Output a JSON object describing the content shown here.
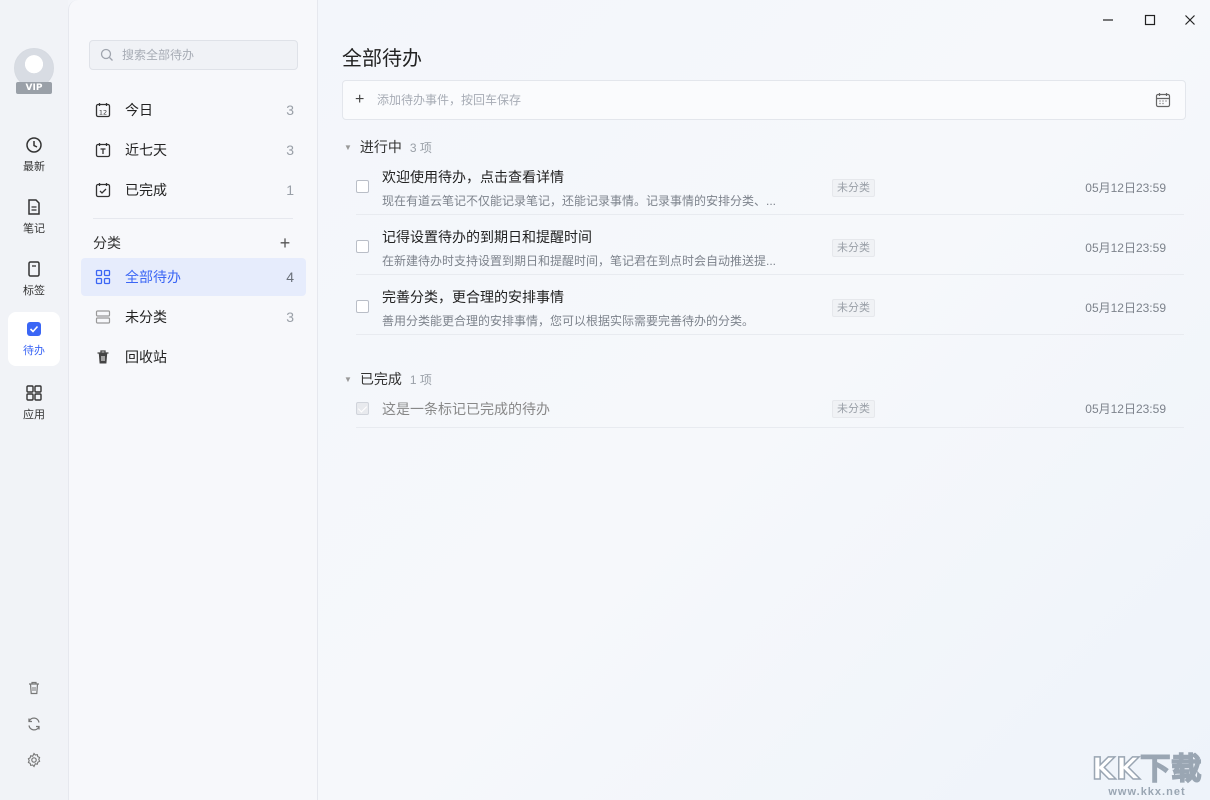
{
  "rail": {
    "vip_badge": "VIP",
    "items": [
      {
        "label": "最新",
        "icon": "clock-icon"
      },
      {
        "label": "笔记",
        "icon": "note-icon"
      },
      {
        "label": "标签",
        "icon": "tag-icon"
      },
      {
        "label": "待办",
        "icon": "todo-check-icon",
        "active": true
      },
      {
        "label": "应用",
        "icon": "apps-grid-icon"
      }
    ],
    "bottom_icons": [
      "trash-icon",
      "sync-icon",
      "settings-gear-icon"
    ],
    "accent_color": "#3b66f5"
  },
  "sidebar": {
    "search_placeholder": "搜索全部待办",
    "smart_lists": [
      {
        "label": "今日",
        "count": "3",
        "icon": "calendar-12-icon"
      },
      {
        "label": "近七天",
        "count": "3",
        "icon": "calendar-t-icon"
      },
      {
        "label": "已完成",
        "count": "1",
        "icon": "calendar-check-icon"
      }
    ],
    "category_header": "分类",
    "add_category_symbol": "+",
    "categories": [
      {
        "label": "全部待办",
        "count": "4",
        "icon": "grid-icon",
        "active": true
      },
      {
        "label": "未分类",
        "count": "3",
        "icon": "uncategorized-icon"
      },
      {
        "label": "回收站",
        "count": "",
        "icon": "trash-icon"
      }
    ]
  },
  "main": {
    "title": "全部待办",
    "add_placeholder": "添加待办事件，按回车保存",
    "add_symbol": "+",
    "in_progress": {
      "label": "进行中",
      "count": "3 项",
      "items": [
        {
          "title": "欢迎使用待办，点击查看详情",
          "desc": "现在有道云笔记不仅能记录笔记，还能记录事情。记录事情的安排分类、...",
          "tag": "未分类",
          "due": "05月12日23:59",
          "done": false
        },
        {
          "title": "记得设置待办的到期日和提醒时间",
          "desc": "在新建待办时支持设置到期日和提醒时间，笔记君在到点时会自动推送提...",
          "tag": "未分类",
          "due": "05月12日23:59",
          "done": false
        },
        {
          "title": "完善分类，更合理的安排事情",
          "desc": "善用分类能更合理的安排事情，您可以根据实际需要完善待办的分类。",
          "tag": "未分类",
          "due": "05月12日23:59",
          "done": false
        }
      ]
    },
    "completed": {
      "label": "已完成",
      "count": "1 项",
      "items": [
        {
          "title": "这是一条标记已完成的待办",
          "tag": "未分类",
          "due": "05月12日23:59",
          "done": true
        }
      ]
    }
  },
  "watermark": {
    "big": "KK下载",
    "small": "www.kkx.net"
  }
}
